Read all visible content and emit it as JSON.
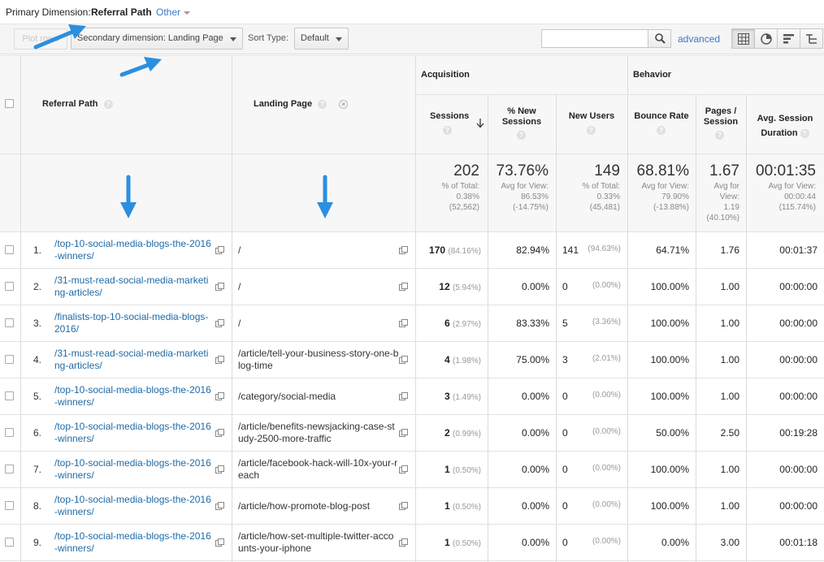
{
  "primary_dimension": {
    "label": "Primary Dimension:",
    "active": "Referral Path",
    "other": "Other"
  },
  "toolbar": {
    "plot_rows": "Plot rows",
    "secondary_dimension": "Secondary dimension: Landing Page",
    "sort_type_label": "Sort Type:",
    "sort_type_value": "Default",
    "search_value": "",
    "advanced": "advanced"
  },
  "header": {
    "col_referral_path": "Referral Path",
    "col_landing_page": "Landing Page",
    "group_acquisition": "Acquisition",
    "group_behavior": "Behavior",
    "col_sessions": "Sessions",
    "col_new_sessions_1": "% New",
    "col_new_sessions_2": "Sessions",
    "col_new_users": "New Users",
    "col_bounce_rate": "Bounce Rate",
    "col_pages_session_1": "Pages /",
    "col_pages_session_2": "Session",
    "col_avg_session_1": "Avg. Session",
    "col_avg_session_2": "Duration",
    "help_glyph": "?",
    "remove_glyph": "×"
  },
  "totals": {
    "sessions": {
      "value": "202",
      "sub1": "% of Total:",
      "sub2": "0.38%",
      "sub3": "(52,562)"
    },
    "new_sessions": {
      "value": "73.76%",
      "sub1": "Avg for View:",
      "sub2": "86.53%",
      "sub3": "(-14.75%)"
    },
    "new_users": {
      "value": "149",
      "sub1": "% of Total:",
      "sub2": "0.33%",
      "sub3": "(45,481)"
    },
    "bounce_rate": {
      "value": "68.81%",
      "sub1": "Avg for View:",
      "sub2": "79.90%",
      "sub3": "(-13.88%)"
    },
    "pages_session": {
      "value": "1.67",
      "sub1": "Avg for",
      "sub2": "View:",
      "sub3": "1.19",
      "sub4": "(40.10%)"
    },
    "avg_duration": {
      "value": "00:01:35",
      "sub1": "Avg for View:",
      "sub2": "00:00:44",
      "sub3": "(115.74%)"
    }
  },
  "rows": [
    {
      "idx": "1.",
      "ref": "/top-10-social-media-blogs-the-2016-winners/",
      "lp": "/",
      "sessions": "170",
      "sessions_pct": "(84.16%)",
      "new_sessions": "82.94%",
      "new_users": "141",
      "new_users_pct": "(94.63%)",
      "bounce": "64.71%",
      "pages": "1.76",
      "duration": "00:01:37"
    },
    {
      "idx": "2.",
      "ref": "/31-must-read-social-media-marketing-articles/",
      "lp": "/",
      "sessions": "12",
      "sessions_pct": "(5.94%)",
      "new_sessions": "0.00%",
      "new_users": "0",
      "new_users_pct": "(0.00%)",
      "bounce": "100.00%",
      "pages": "1.00",
      "duration": "00:00:00"
    },
    {
      "idx": "3.",
      "ref": "/finalists-top-10-social-media-blogs-2016/",
      "lp": "/",
      "sessions": "6",
      "sessions_pct": "(2.97%)",
      "new_sessions": "83.33%",
      "new_users": "5",
      "new_users_pct": "(3.36%)",
      "bounce": "100.00%",
      "pages": "1.00",
      "duration": "00:00:00"
    },
    {
      "idx": "4.",
      "ref": "/31-must-read-social-media-marketing-articles/",
      "lp": "/article/tell-your-business-story-one-blog-time",
      "sessions": "4",
      "sessions_pct": "(1.98%)",
      "new_sessions": "75.00%",
      "new_users": "3",
      "new_users_pct": "(2.01%)",
      "bounce": "100.00%",
      "pages": "1.00",
      "duration": "00:00:00"
    },
    {
      "idx": "5.",
      "ref": "/top-10-social-media-blogs-the-2016-winners/",
      "lp": "/category/social-media",
      "sessions": "3",
      "sessions_pct": "(1.49%)",
      "new_sessions": "0.00%",
      "new_users": "0",
      "new_users_pct": "(0.00%)",
      "bounce": "100.00%",
      "pages": "1.00",
      "duration": "00:00:00"
    },
    {
      "idx": "6.",
      "ref": "/top-10-social-media-blogs-the-2016-winners/",
      "lp": "/article/benefits-newsjacking-case-study-2500-more-traffic",
      "sessions": "2",
      "sessions_pct": "(0.99%)",
      "new_sessions": "0.00%",
      "new_users": "0",
      "new_users_pct": "(0.00%)",
      "bounce": "50.00%",
      "pages": "2.50",
      "duration": "00:19:28"
    },
    {
      "idx": "7.",
      "ref": "/top-10-social-media-blogs-the-2016-winners/",
      "lp": "/article/facebook-hack-will-10x-your-reach",
      "sessions": "1",
      "sessions_pct": "(0.50%)",
      "new_sessions": "0.00%",
      "new_users": "0",
      "new_users_pct": "(0.00%)",
      "bounce": "100.00%",
      "pages": "1.00",
      "duration": "00:00:00"
    },
    {
      "idx": "8.",
      "ref": "/top-10-social-media-blogs-the-2016-winners/",
      "lp": "/article/how-promote-blog-post",
      "sessions": "1",
      "sessions_pct": "(0.50%)",
      "new_sessions": "0.00%",
      "new_users": "0",
      "new_users_pct": "(0.00%)",
      "bounce": "100.00%",
      "pages": "1.00",
      "duration": "00:00:00"
    },
    {
      "idx": "9.",
      "ref": "/top-10-social-media-blogs-the-2016-winners/",
      "lp": "/article/how-set-multiple-twitter-accounts-your-iphone",
      "sessions": "1",
      "sessions_pct": "(0.50%)",
      "new_sessions": "0.00%",
      "new_users": "0",
      "new_users_pct": "(0.00%)",
      "bounce": "0.00%",
      "pages": "3.00",
      "duration": "00:01:18"
    }
  ],
  "colors": {
    "link": "#1f6aa5",
    "accent_arrow": "#2b8fe0",
    "header_bg": "#f7f7f7"
  },
  "icons": [
    "search-icon",
    "table-view-icon",
    "pie-view-icon",
    "performance-view-icon",
    "pivot-view-icon",
    "help-icon",
    "remove-icon",
    "popout-icon",
    "sort-desc-arrow-icon",
    "annotation-arrow-icon"
  ]
}
